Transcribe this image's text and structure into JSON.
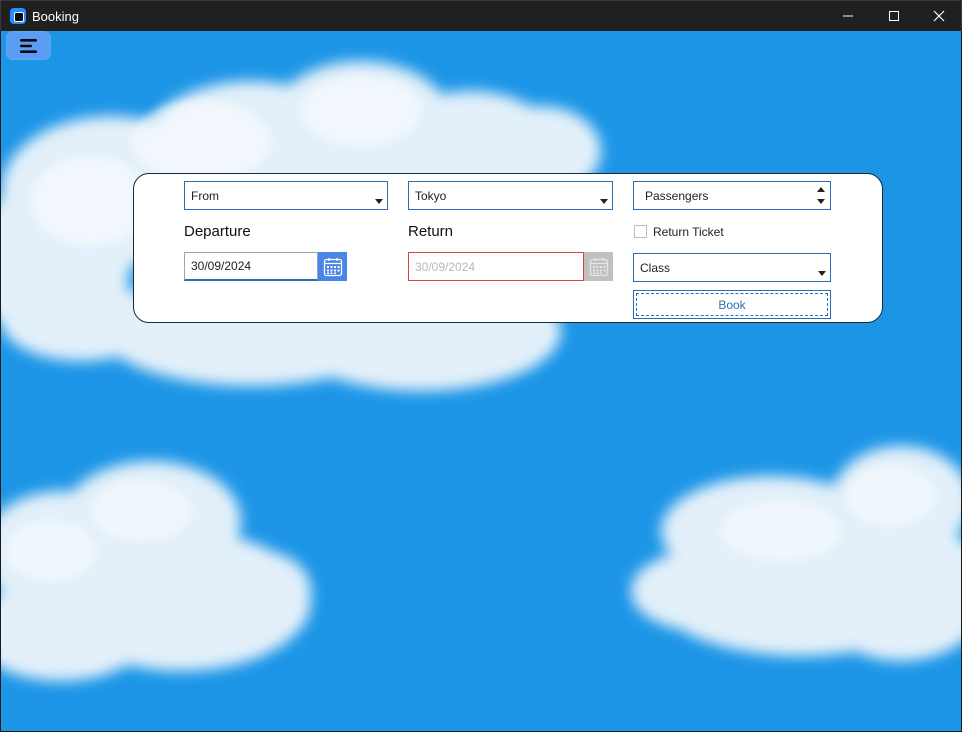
{
  "window": {
    "title": "Booking",
    "minimize_icon": "minimize-icon",
    "maximize_icon": "maximize-icon",
    "close_icon": "close-icon"
  },
  "toolbar": {
    "menu_icon": "hamburger-menu-icon"
  },
  "form": {
    "from": {
      "value": "From"
    },
    "to": {
      "value": "Tokyo"
    },
    "passengers": {
      "value": "Passengers"
    },
    "departure": {
      "label": "Departure",
      "date": "30/09/2024"
    },
    "return": {
      "label": "Return",
      "date": "30/09/2024",
      "enabled": false
    },
    "return_ticket": {
      "label": "Return Ticket",
      "checked": false
    },
    "class": {
      "value": "Class"
    },
    "book": {
      "label": "Book"
    }
  },
  "colors": {
    "sky": "#1c95e6",
    "accent": "#2a6fb5",
    "calendar_active": "#4a86e8",
    "calendar_disabled": "#c0c0c0",
    "error_border": "#d64545"
  }
}
